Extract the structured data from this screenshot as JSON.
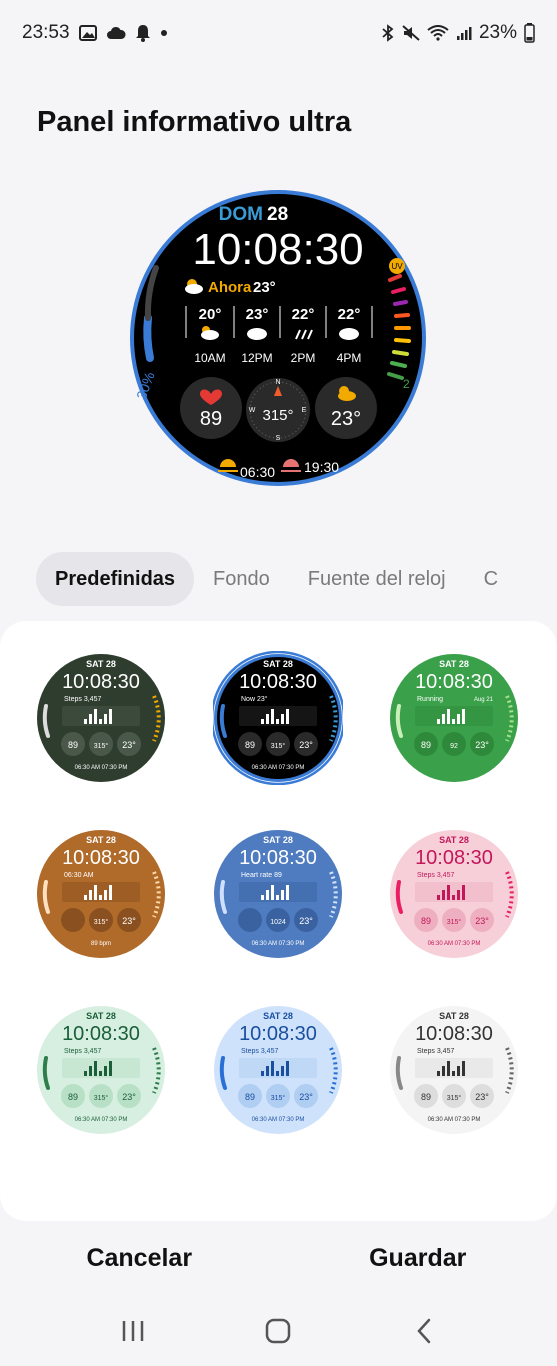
{
  "status_bar": {
    "time": "23:53",
    "battery": "23%",
    "left_icons": [
      "gallery-icon",
      "cloud-icon",
      "bell-icon",
      "dot-icon"
    ],
    "right_icons": [
      "bluetooth-icon",
      "mute-icon",
      "wifi-icon",
      "signal-icon",
      "battery-icon"
    ]
  },
  "page": {
    "title": "Panel informativo ultra"
  },
  "watch": {
    "day": "DOM",
    "date": "28",
    "time": "10:08:30",
    "now_label": "Ahora",
    "now_temp": "23°",
    "uv_label": "UV",
    "forecast": [
      {
        "temp": "20°",
        "time": "10AM",
        "icon": "partly-cloudy-icon"
      },
      {
        "temp": "23°",
        "time": "12PM",
        "icon": "cloud-icon"
      },
      {
        "temp": "22°",
        "time": "2PM",
        "icon": "rain-icon"
      },
      {
        "temp": "22°",
        "time": "4PM",
        "icon": "cloud-icon"
      }
    ],
    "battery_label": "30%",
    "right_gauge_label": "2",
    "heart_value": "89",
    "compass_value": "315°",
    "compass_n": "N",
    "compass_e": "E",
    "compass_s": "S",
    "compass_w": "W",
    "weather_value": "23°",
    "sunrise": "06:30",
    "sunset": "19:30",
    "accent_color": "#3a7bd5"
  },
  "tabs": [
    {
      "label": "Predefinidas",
      "active": true
    },
    {
      "label": "Fondo",
      "active": false
    },
    {
      "label": "Fuente del reloj",
      "active": false
    },
    {
      "label": "C",
      "active": false
    }
  ],
  "presets": [
    {
      "day": "SAT 28",
      "time": "10:08:30",
      "label": "Steps 3,457",
      "style": "dark-green",
      "c1": "89",
      "c2": "315°",
      "c3": "23°",
      "footer": "06:30 AM  07:30 PM"
    },
    {
      "day": "SAT 28",
      "time": "10:08:30",
      "label": "Now 23°",
      "style": "black-selected",
      "c1": "89",
      "c2": "315°",
      "c3": "23°",
      "footer": "06:30 AM  07:30 PM"
    },
    {
      "day": "SAT 28",
      "time": "10:08:30",
      "label": "Running",
      "label2": "Aug 21",
      "style": "green",
      "c1": "89",
      "c2": "92",
      "c3": "23°",
      "footer": ""
    },
    {
      "day": "SAT 28",
      "time": "10:08:30",
      "label": "06:30 AM",
      "style": "brown",
      "c1": "",
      "c2": "315°",
      "c3": "23°",
      "footer": "89 bpm"
    },
    {
      "day": "SAT 28",
      "time": "10:08:30",
      "label": "Heart rate 89",
      "style": "blue",
      "c1": "",
      "c2": "1024",
      "c3": "23°",
      "footer": "06:30 AM  07:30 PM"
    },
    {
      "day": "SAT 28",
      "time": "10:08:30",
      "label": "Steps 3,457",
      "style": "pink",
      "c1": "89",
      "c2": "315°",
      "c3": "23°",
      "footer": "06:30 AM  07:30 PM"
    },
    {
      "day": "SAT 28",
      "time": "10:08:30",
      "label": "Steps 3,457",
      "style": "mint",
      "c1": "89",
      "c2": "315°",
      "c3": "23°",
      "footer": "06:30 AM  07:30 PM"
    },
    {
      "day": "SAT 28",
      "time": "10:08:30",
      "label": "Steps 3,457",
      "style": "light-blue",
      "c1": "89",
      "c2": "315°",
      "c3": "23°",
      "footer": "06:30 AM  07:30 PM"
    },
    {
      "day": "SAT 28",
      "time": "10:08:30",
      "label": "Steps 3,457",
      "style": "white",
      "c1": "89",
      "c2": "315°",
      "c3": "23°",
      "footer": "06:30 AM  07:30 PM"
    }
  ],
  "actions": {
    "cancel": "Cancelar",
    "save": "Guardar"
  },
  "nav": {
    "recents_icon": "recents-icon",
    "home_icon": "home-icon",
    "back_icon": "back-icon"
  }
}
